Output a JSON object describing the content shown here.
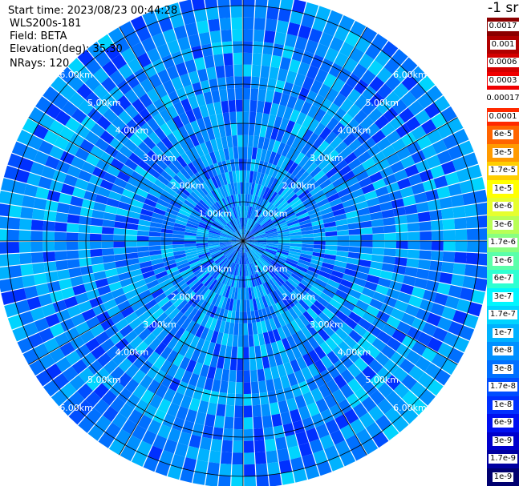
{
  "header": {
    "start_time": "Start time: 2023/08/23 00:44:28",
    "instrument": "WLS200s-181",
    "field": "Field: BETA",
    "elevation": "Elevation(deg): 35.30",
    "nrays": "NRays: 120"
  },
  "unit_label": "-1 sr",
  "chart_data": {
    "type": "heatmap",
    "projection": "polar PPI",
    "field": "BETA",
    "elevation_deg": 35.3,
    "n_rays": 120,
    "range_rings_km": [
      1,
      2,
      3,
      4,
      5,
      6
    ],
    "range_labels": [
      "1.00km",
      "2.00km",
      "3.00km",
      "4.00km",
      "5.00km",
      "6.00km"
    ],
    "max_range_km": 6.3,
    "radial_lines_deg": [
      0,
      30,
      60,
      90,
      120,
      150,
      180,
      210,
      240,
      270,
      300,
      330
    ],
    "dominant_value_range": [
      "1e-8",
      "1e-7"
    ],
    "colorbar": [
      {
        "label": "0.0017",
        "color": "#8b0000"
      },
      {
        "label": "0.001",
        "color": "#b00000"
      },
      {
        "label": "0.0006",
        "color": "#d40000"
      },
      {
        "label": "0.0003",
        "color": "#f00000"
      },
      {
        "label": "0.00017",
        "color": "#ffffff"
      },
      {
        "label": "0.0001",
        "color": "#ff2a00"
      },
      {
        "label": "6e-5",
        "color": "#ff6400"
      },
      {
        "label": "3e-5",
        "color": "#ff9a00"
      },
      {
        "label": "1.7e-5",
        "color": "#ffce00"
      },
      {
        "label": "1e-5",
        "color": "#ffff00"
      },
      {
        "label": "6e-6",
        "color": "#e6ff2e"
      },
      {
        "label": "3e-6",
        "color": "#b8ff55"
      },
      {
        "label": "1.7e-6",
        "color": "#88ff80"
      },
      {
        "label": "1e-6",
        "color": "#5affaa"
      },
      {
        "label": "6e-7",
        "color": "#2effd2"
      },
      {
        "label": "3e-7",
        "color": "#00f6ff"
      },
      {
        "label": "1.7e-7",
        "color": "#00d4ff"
      },
      {
        "label": "1e-7",
        "color": "#00b2ff"
      },
      {
        "label": "6e-8",
        "color": "#0090ff"
      },
      {
        "label": "3e-8",
        "color": "#0070ff"
      },
      {
        "label": "1.7e-8",
        "color": "#004eff"
      },
      {
        "label": "1e-8",
        "color": "#0030ff"
      },
      {
        "label": "6e-9",
        "color": "#0010f0"
      },
      {
        "label": "3e-9",
        "color": "#0000cc"
      },
      {
        "label": "1.7e-9",
        "color": "#0000a0"
      },
      {
        "label": "1e-9",
        "color": "#000070"
      }
    ]
  }
}
